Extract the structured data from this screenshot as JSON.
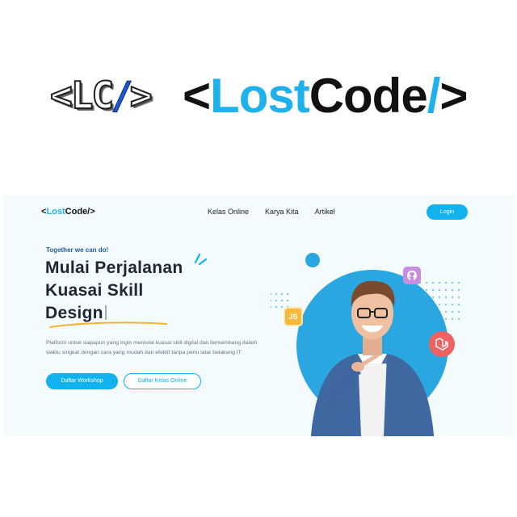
{
  "brand": {
    "mark_open": "<",
    "mark_text": "LC",
    "mark_slash": "/",
    "mark_close": ">",
    "word_open": "<",
    "word_lost": "Lost",
    "word_code": "Code",
    "word_slash": "/",
    "word_close": ">"
  },
  "nav": {
    "logo_open": "<",
    "logo_lost": "Lost",
    "logo_code": "Code",
    "logo_close": "/>",
    "links": [
      "Kelas Online",
      "Karya Kita",
      "Artikel"
    ],
    "login_label": "Login"
  },
  "hero": {
    "tagline": "Together we can do!",
    "title_line1": "Mulai Perjalanan",
    "title_line2": "Kuasai Skill",
    "title_line3": "Design",
    "description": "Platform untuk siapapun yang ingin memulai kuasai skill digital dan berkembang dalam waktu singkat dengan cara yang mudah dan efektif tanpa perlu latar belakang IT",
    "primary_button": "Daftar Workshop",
    "secondary_button": "Daftar Kelas Online",
    "js_badge": "JS"
  },
  "colors": {
    "accent": "#11b2ee",
    "brand_blue": "#1fb1ec",
    "dark": "#1e2533",
    "panel_bg": "#f3fbfd",
    "circle": "#2aa6e0",
    "underline": "#f2b233"
  },
  "icons": [
    "sparkle-icon",
    "js-icon",
    "git-icon",
    "laravel-icon"
  ]
}
